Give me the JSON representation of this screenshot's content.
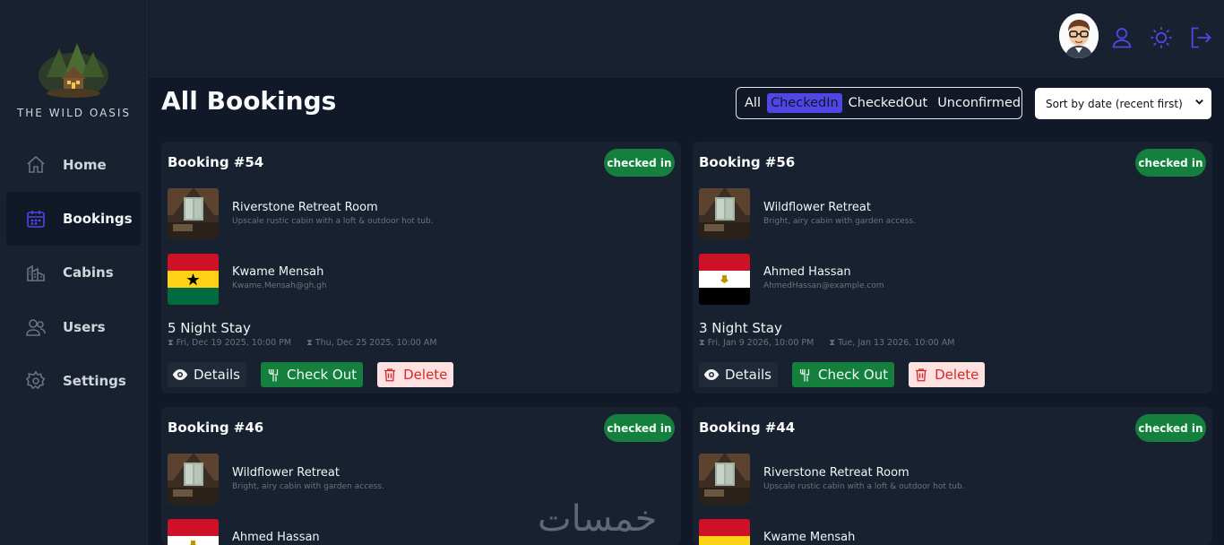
{
  "app": {
    "brand": "THE WILD OASIS"
  },
  "nav": [
    {
      "label": "Home",
      "icon": "home-icon"
    },
    {
      "label": "Bookings",
      "icon": "calendar-icon",
      "active": true
    },
    {
      "label": "Cabins",
      "icon": "cabins-icon"
    },
    {
      "label": "Users",
      "icon": "users-icon"
    },
    {
      "label": "Settings",
      "icon": "gear-icon"
    }
  ],
  "header": {
    "icons": [
      "user-icon",
      "sun-icon",
      "logout-icon"
    ]
  },
  "page": {
    "title": "All Bookings"
  },
  "filter": {
    "options": [
      "All",
      "CheckedIn",
      "CheckedOut",
      "Unconfirmed"
    ],
    "active": "CheckedIn"
  },
  "sort": {
    "selected": "Sort by date (recent first)"
  },
  "bookings": [
    {
      "title": "Booking #54",
      "status": "checked in",
      "cabin": {
        "name": "Riverstone Retreat Room",
        "desc": "Upscale rustic cabin with a loft & outdoor hot tub."
      },
      "guest": {
        "name": "Kwame Mensah",
        "email": "Kwame.Mensah@gh.gh",
        "flag": "ghana"
      },
      "stay": "5 Night Stay",
      "start": "Fri, Dec 19 2025, 10:00 PM",
      "end": "Thu, Dec 25 2025, 10:00 AM"
    },
    {
      "title": "Booking #56",
      "status": "checked in",
      "cabin": {
        "name": "Wildflower Retreat",
        "desc": "Bright, airy cabin with garden access."
      },
      "guest": {
        "name": "Ahmed Hassan",
        "email": "AhmedHassan@example.com",
        "flag": "egypt"
      },
      "stay": "3 Night Stay",
      "start": "Fri, Jan 9 2026, 10:00 PM",
      "end": "Tue, Jan 13 2026, 10:00 AM"
    },
    {
      "title": "Booking #46",
      "status": "checked in",
      "cabin": {
        "name": "Wildflower Retreat",
        "desc": "Bright, airy cabin with garden access."
      },
      "guest": {
        "name": "Ahmed Hassan",
        "flag": "egypt"
      }
    },
    {
      "title": "Booking #44",
      "status": "checked in",
      "cabin": {
        "name": "Riverstone Retreat Room",
        "desc": "Upscale rustic cabin with a loft & outdoor hot tub."
      },
      "guest": {
        "name": "Kwame Mensah",
        "flag": "ghana"
      }
    }
  ],
  "actions": {
    "details": "Details",
    "checkout": "Check Out",
    "delete": "Delete"
  },
  "watermark": "خمسات",
  "colors": {
    "accent": "#4f46e5",
    "success": "#15803d",
    "danger": "#dc2626",
    "bg": "#111827",
    "panel": "#18212f"
  }
}
